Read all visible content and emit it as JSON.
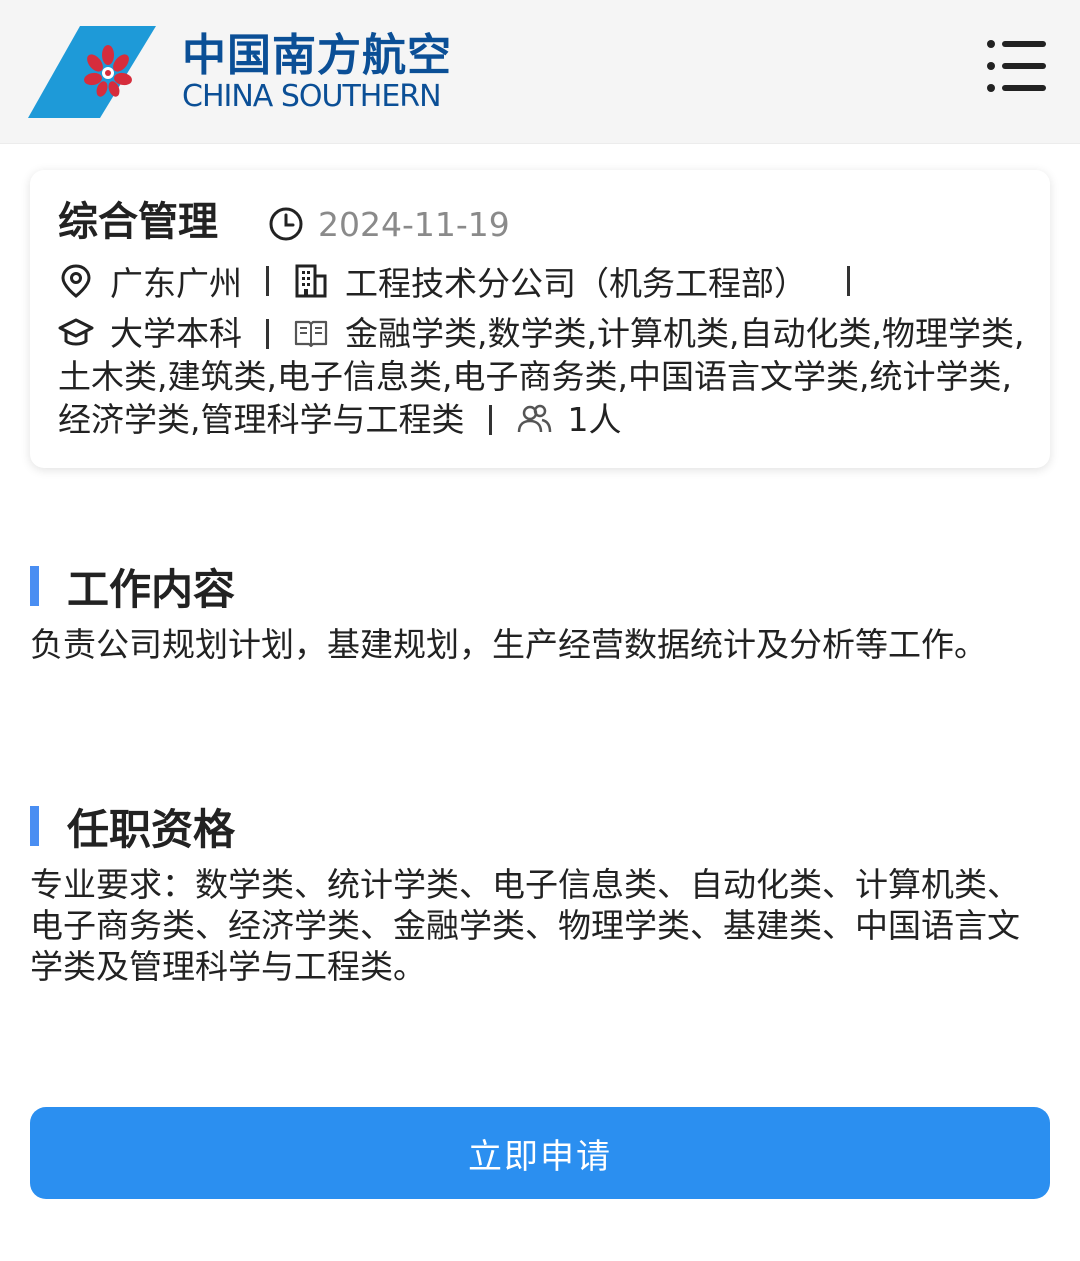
{
  "header": {
    "logo_cn": "中国南方航空",
    "logo_en": "CHINA SOUTHERN",
    "menu_icon": "hamburger-menu-icon",
    "brand_color": "#0b4f96"
  },
  "job": {
    "title": "综合管理",
    "date": "2024-11-19",
    "location": "广东广州",
    "company": "工程技术分公司（机务工程部）",
    "education": "大学本科",
    "majors": "金融学类,数学类,计算机类,自动化类,物理学类,土木类,建筑类,电子信息类,电子商务类,中国语言文学类,统计学类,经济学类,管理科学与工程类",
    "headcount": "1人",
    "icons": {
      "date": "clock-icon",
      "location": "location-pin-icon",
      "company": "building-icon",
      "education": "graduation-cap-icon",
      "majors": "book-icon",
      "headcount": "people-icon"
    }
  },
  "sections": {
    "work": {
      "title": "工作内容",
      "body": "负责公司规划计划，基建规划，生产经营数据统计及分析等工作。"
    },
    "qualification": {
      "title": "任职资格",
      "body": "专业要求：数学类、统计学类、电子信息类、自动化类、计算机类、电子商务类、经济学类、金融学类、物理学类、基建类、中国语言文学类及管理科学与工程类。"
    }
  },
  "apply_button": {
    "label": "立即申请",
    "color": "#2b8ff0"
  },
  "colors": {
    "accent_bar": "#4a8ef2",
    "muted_text": "#8a8a8a"
  }
}
